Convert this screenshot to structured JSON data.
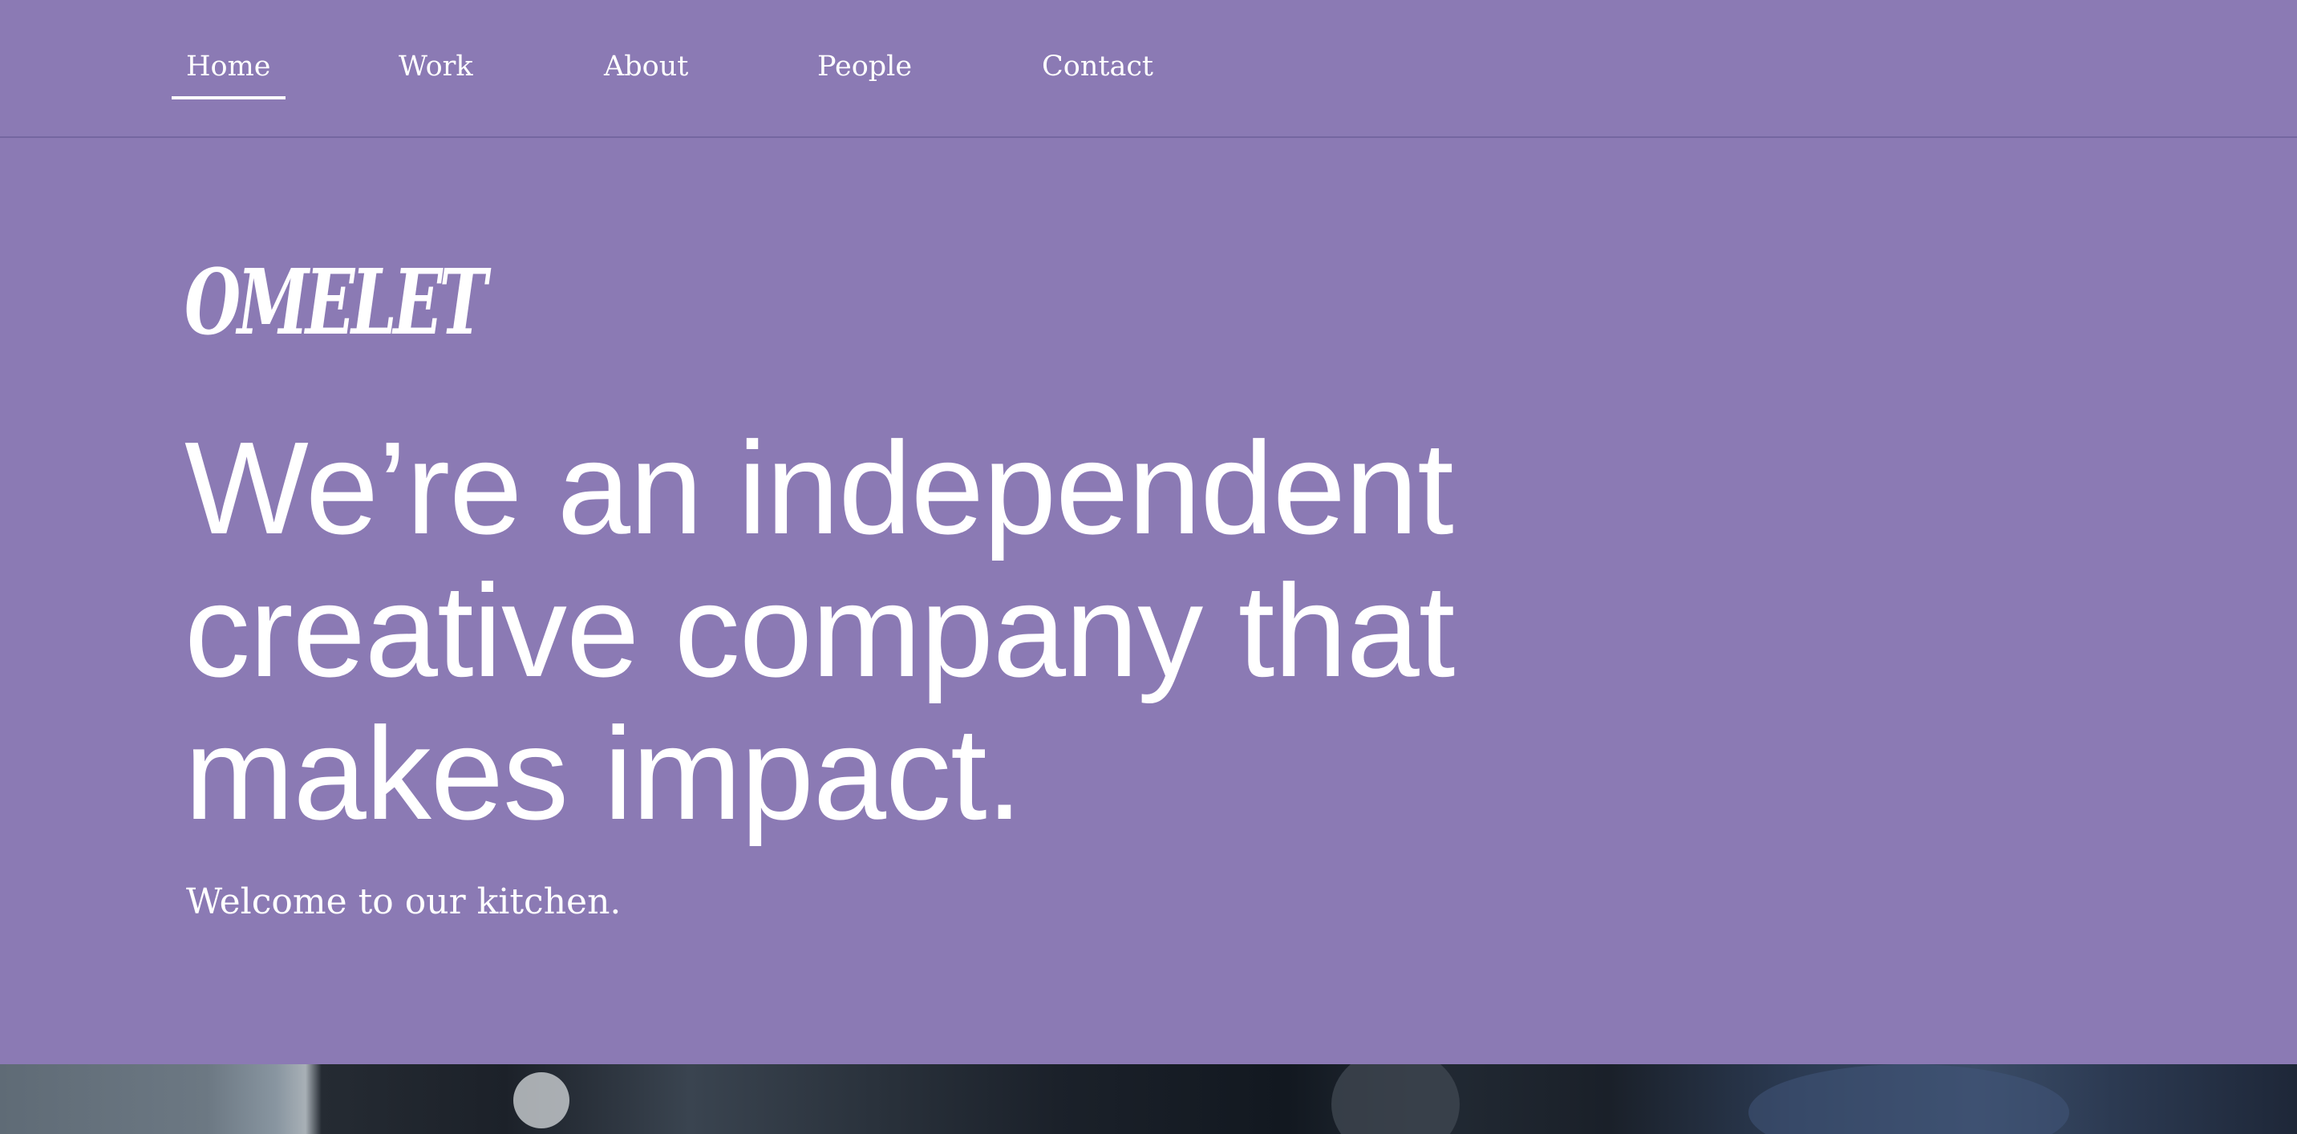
{
  "nav": {
    "items": [
      {
        "label": "Home",
        "active": true
      },
      {
        "label": "Work",
        "active": false
      },
      {
        "label": "About",
        "active": false
      },
      {
        "label": "People",
        "active": false
      },
      {
        "label": "Contact",
        "active": false
      }
    ]
  },
  "brand": {
    "logo_text": "OMELET"
  },
  "hero": {
    "headline": "We’re an independent creative company that makes impact.",
    "subline": "Welcome to our kitchen."
  },
  "colors": {
    "background": "#8b7ab4",
    "text": "#ffffff"
  }
}
